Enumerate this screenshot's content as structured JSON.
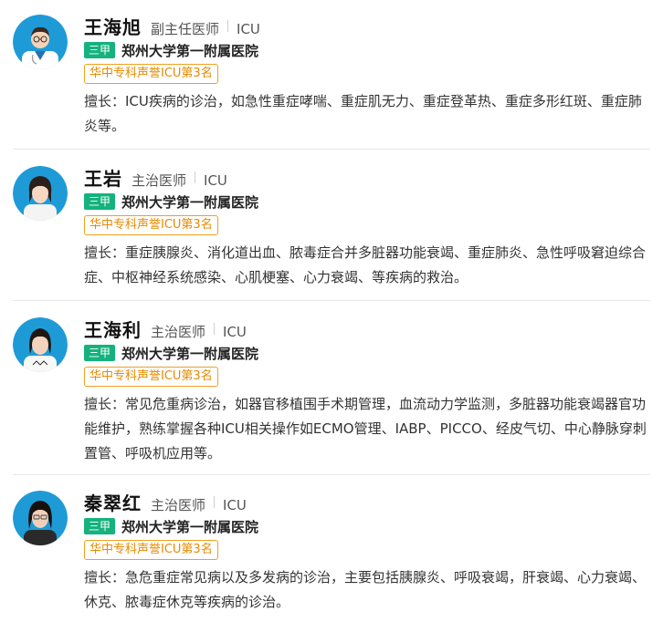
{
  "colors": {
    "level_badge": "#15b27e",
    "honor": "#e88a00",
    "avatar_bg": "#1e9bd7"
  },
  "doctors": [
    {
      "name": "王海旭",
      "title": "副主任医师",
      "dept": "ICU",
      "level": "三甲",
      "hospital": "郑州大学第一附属医院",
      "honor": "华中专科声誉ICU第3名",
      "skill": "擅长：ICU疾病的诊治，如急性重症哮喘、重症肌无力、重症登革热、重症多形红斑、重症肺炎等。",
      "avatar": "cartoon-doctor-avatar"
    },
    {
      "name": "王岩",
      "title": "主治医师",
      "dept": "ICU",
      "level": "三甲",
      "hospital": "郑州大学第一附属医院",
      "honor": "华中专科声誉ICU第3名",
      "skill": "擅长：重症胰腺炎、消化道出血、脓毒症合并多脏器功能衰竭、重症肺炎、急性呼吸窘迫综合症、中枢神经系统感染、心肌梗塞、心力衰竭、等疾病的救治。",
      "avatar": "doctor-photo-avatar"
    },
    {
      "name": "王海利",
      "title": "主治医师",
      "dept": "ICU",
      "level": "三甲",
      "hospital": "郑州大学第一附属医院",
      "honor": "华中专科声誉ICU第3名",
      "skill": "擅长：常见危重病诊治，如器官移植围手术期管理，血流动力学监测，多脏器功能衰竭器官功能维护，熟练掌握各种ICU相关操作如ECMO管理、IABP、PICCO、经皮气切、中心静脉穿刺置管、呼吸机应用等。",
      "avatar": "doctor-photo-avatar"
    },
    {
      "name": "秦翠红",
      "title": "主治医师",
      "dept": "ICU",
      "level": "三甲",
      "hospital": "郑州大学第一附属医院",
      "honor": "华中专科声誉ICU第3名",
      "skill": "擅长：急危重症常见病以及多发病的诊治，主要包括胰腺炎、呼吸衰竭，肝衰竭、心力衰竭、休克、脓毒症休克等疾病的诊治。",
      "avatar": "doctor-photo-avatar"
    }
  ]
}
